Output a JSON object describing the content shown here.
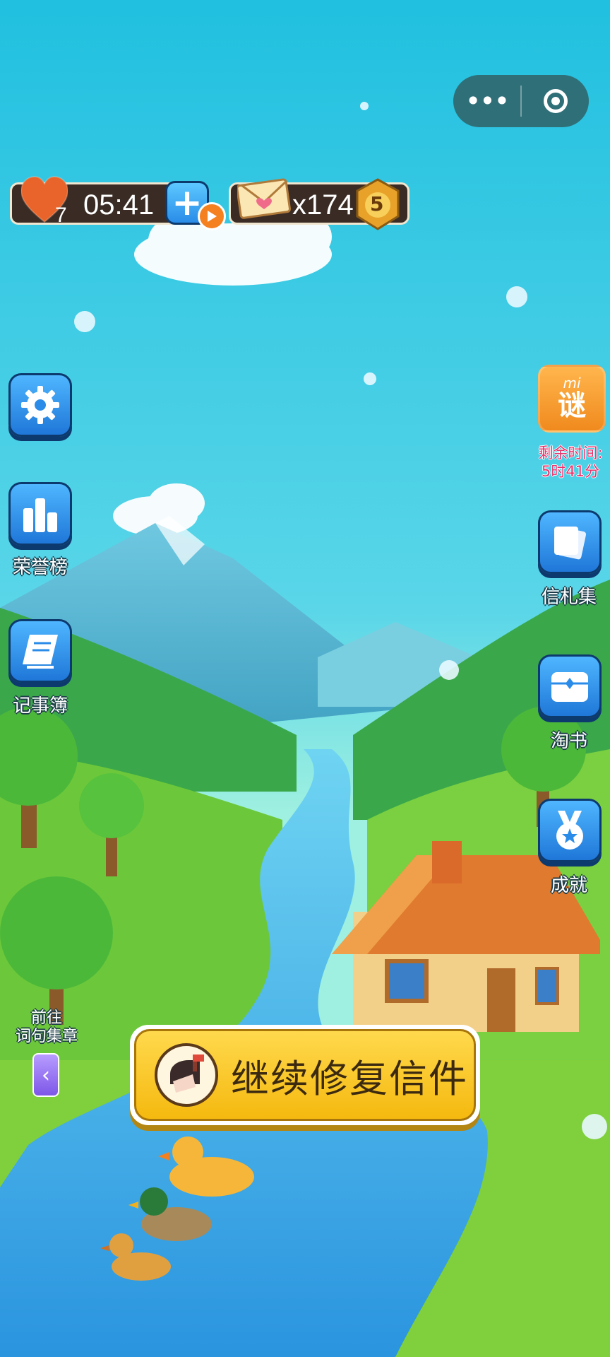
{
  "capsule": {
    "more_icon": "more-dots-icon",
    "close_icon": "target-circle-icon"
  },
  "top_bar": {
    "lives": {
      "count": "7",
      "timer": "05:41",
      "add_icon": "plus-icon",
      "video_icon": "play-icon"
    },
    "letters": {
      "count": "x174",
      "level": "5"
    }
  },
  "left_menu": {
    "settings_icon": "gear-icon",
    "leaderboard_label": "荣誉榜",
    "notebook_label": "记事簿",
    "goto_label_line1": "前往",
    "goto_label_line2": "词句集章",
    "goto_icon": "chevron-left-icon"
  },
  "right_menu": {
    "riddle_top": "mi",
    "riddle_char": "谜",
    "remaining_label": "剩余时间:",
    "remaining_value": "5时41分",
    "letters_label": "信札集",
    "taoshu_label": "淘书",
    "achievements_label": "成就"
  },
  "main_button": {
    "label": "继续修复信件",
    "icon": "mailbox-icon"
  },
  "colors": {
    "sky_top": "#2ec4e6",
    "sky_bottom": "#7fe6e0",
    "button_yellow": "#f5b90f",
    "side_blue": "#2a8ce8",
    "riddle_orange": "#f59a2a",
    "remaining_pink": "#e8306a"
  }
}
